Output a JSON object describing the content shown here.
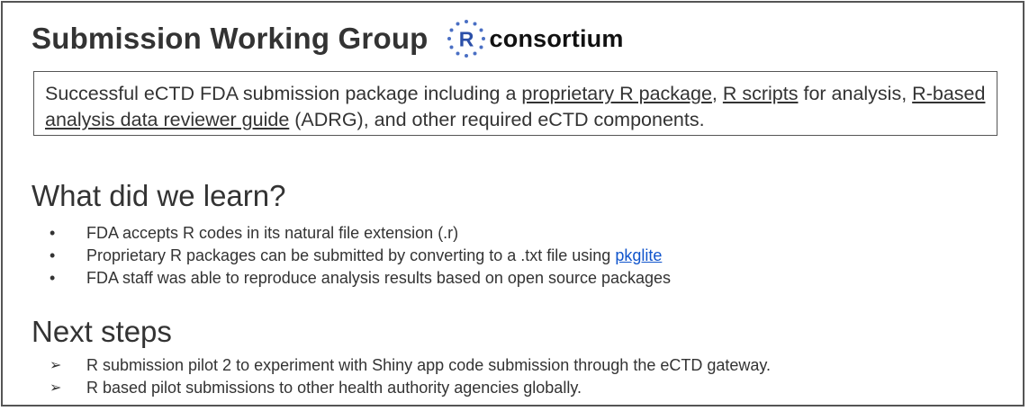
{
  "header": {
    "title": "Submission Working Group",
    "logo": {
      "letter": "R",
      "text": "consortium",
      "dot_color": "#4a6fc4",
      "letter_color": "#2b4fa8"
    }
  },
  "summary": {
    "part1": "Successful eCTD FDA submission package including a ",
    "link1": "proprietary R package",
    "part2": ", ",
    "link2": "R scripts",
    "part3": " for analysis, ",
    "link3": "R-based analysis data reviewer guide",
    "part4": " (ADRG), and other required eCTD components."
  },
  "learn": {
    "heading": "What did we learn?",
    "bullet_marker": "•",
    "items": [
      {
        "text": "FDA accepts R codes in its natural file extension (.r)"
      },
      {
        "text": "Proprietary R packages can be submitted by converting to a .txt file using ",
        "link": "pkglite"
      },
      {
        "text": "FDA staff was able to reproduce analysis results based on open source packages"
      }
    ]
  },
  "next": {
    "heading": "Next steps",
    "arrow_marker": "➢",
    "items": [
      {
        "text": "R submission pilot 2 to experiment with Shiny app code submission through the eCTD gateway."
      },
      {
        "text": "R based pilot submissions to other health authority agencies globally."
      }
    ]
  },
  "colors": {
    "text": "#333333",
    "link": "#1155cc",
    "border": "#555555"
  }
}
